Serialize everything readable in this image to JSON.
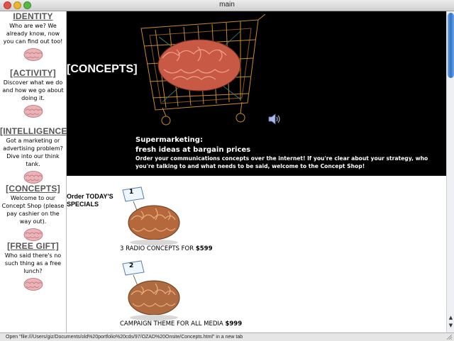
{
  "window": {
    "title": "main"
  },
  "colors": {
    "banner_bg": "#000000",
    "nav_heading": "#555555",
    "brain_pink": "#e8a0a8",
    "scroll_thumb": "#2f72c9"
  },
  "sidebar": {
    "items": [
      {
        "heading": "IDENTITY",
        "desc": "Who are we? We already know, now you can find out too!",
        "icon": "brain-icon"
      },
      {
        "heading": "[ACTIVITY]",
        "desc": "Discover what we do and how we go about doing it.",
        "icon": "brain-icon"
      },
      {
        "heading": "[INTELLIGENCE]",
        "desc": "Got a marketing or advertising problem? Dive into our think tank.",
        "icon": "brain-icon"
      },
      {
        "heading": "[CONCEPTS]",
        "desc": "Welcome to our Concept Shop (please pay cashier on the way out).",
        "icon": "brain-icon"
      },
      {
        "heading": "[FREE GIFT]",
        "desc": "Who said there's no such thing as a free lunch?",
        "icon": "brain-icon"
      }
    ]
  },
  "banner": {
    "title": "[CONCEPTS]",
    "tagline1": "Supermarketing:",
    "tagline2": "fresh ideas at bargain prices",
    "description": "Order your communications concepts over the internet! If you're clear about your strategy, who you're talking to and what needs to be said, welcome to the Concept Shop!"
  },
  "specials": {
    "heading": "Order TODAY'S SPECIALS",
    "items": [
      {
        "number": "1",
        "label": "3 RADIO CONCEPTS FOR",
        "price": "$599"
      },
      {
        "number": "2",
        "label": "CAMPAIGN THEME FOR ALL MEDIA",
        "price": "$999"
      }
    ]
  },
  "status": {
    "text": "Open \"file:///Users/giz/Documents/old%20portfolio%20cds/97/OZAD%20Onsite/Concepts.html\" in a new tab"
  }
}
